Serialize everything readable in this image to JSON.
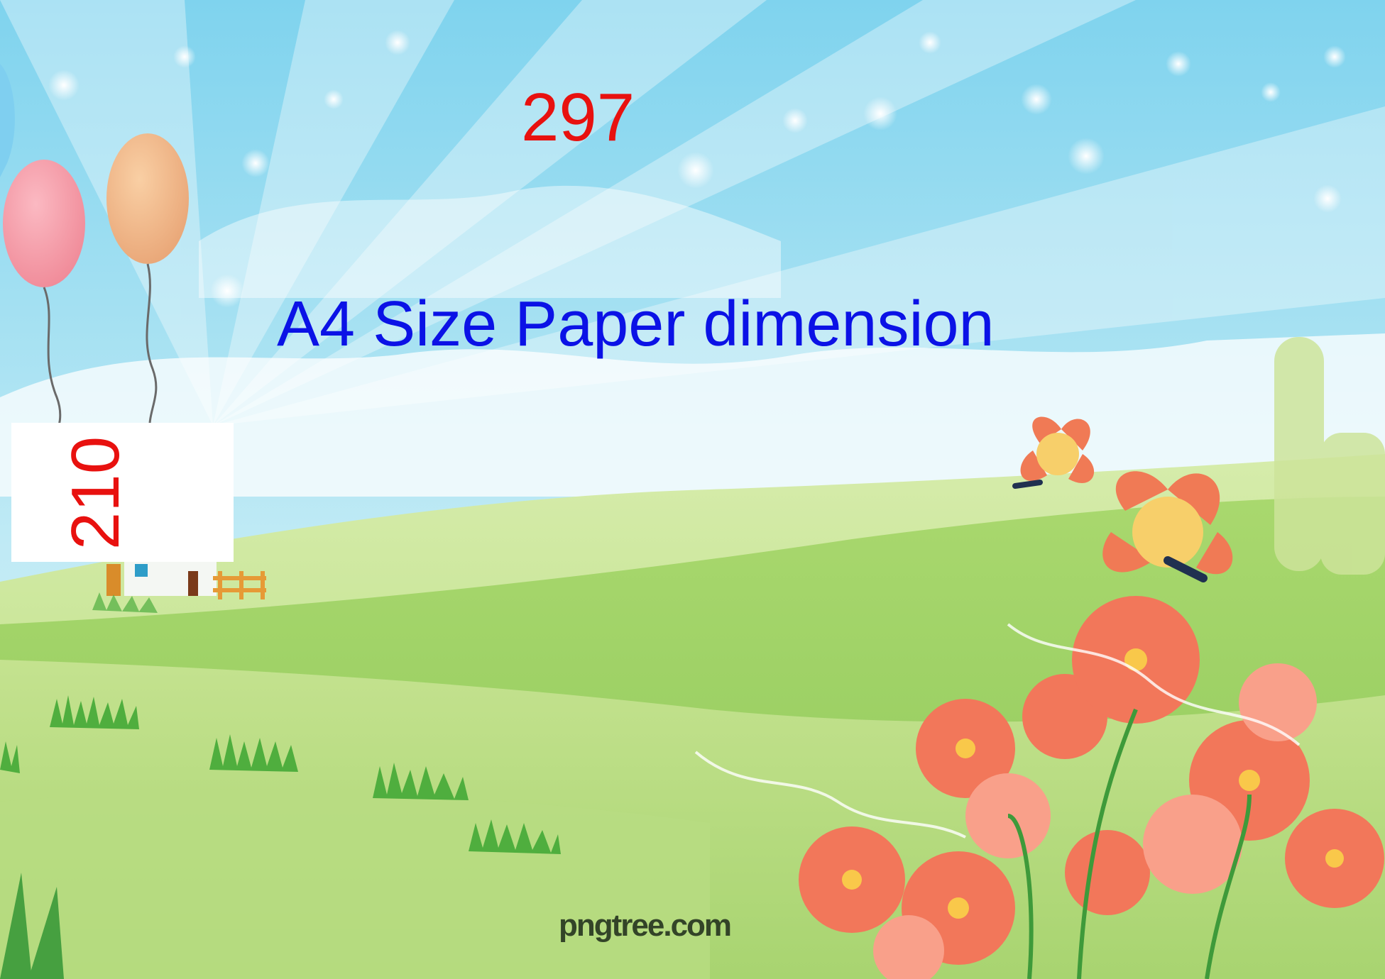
{
  "labels": {
    "width": "297",
    "height": "210",
    "title": "A4 Size Paper dimension"
  },
  "watermark": "pngtree.com",
  "colors": {
    "dimension_text": "#e8110f",
    "title_text": "#0b12e6",
    "sky": "#8fd9ef",
    "grass": "#9fd16a",
    "flower": "#f2775a"
  },
  "illustration": {
    "icons": [
      "balloon-icon",
      "balloon-icon",
      "cloud-icon",
      "butterfly-icon",
      "butterfly-icon",
      "flower-icon",
      "house-icon",
      "grass-icon"
    ]
  }
}
